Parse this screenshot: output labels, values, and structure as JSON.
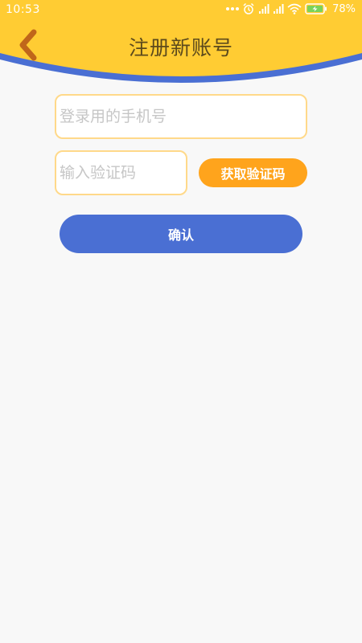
{
  "status_bar": {
    "time": "10:53",
    "battery": "78%",
    "icons": [
      "more-dots-icon",
      "alarm-icon",
      "signal-icon",
      "signal-icon",
      "wifi-icon",
      "battery-charging-icon"
    ]
  },
  "header": {
    "title": "注册新账号",
    "back_icon": "chevron-left-icon",
    "background_color": "#ffcc33",
    "accent_wave_color": "#4a6fd3"
  },
  "form": {
    "phone_placeholder": "登录用的手机号",
    "phone_value": "",
    "code_placeholder": "输入验证码",
    "code_value": "",
    "get_code_label": "获取验证码",
    "confirm_label": "确认"
  },
  "colors": {
    "input_border": "#ffd98a",
    "get_code_button": "#ffa41c",
    "confirm_button": "#4a6fd3",
    "page_background": "#f8f8f8"
  }
}
